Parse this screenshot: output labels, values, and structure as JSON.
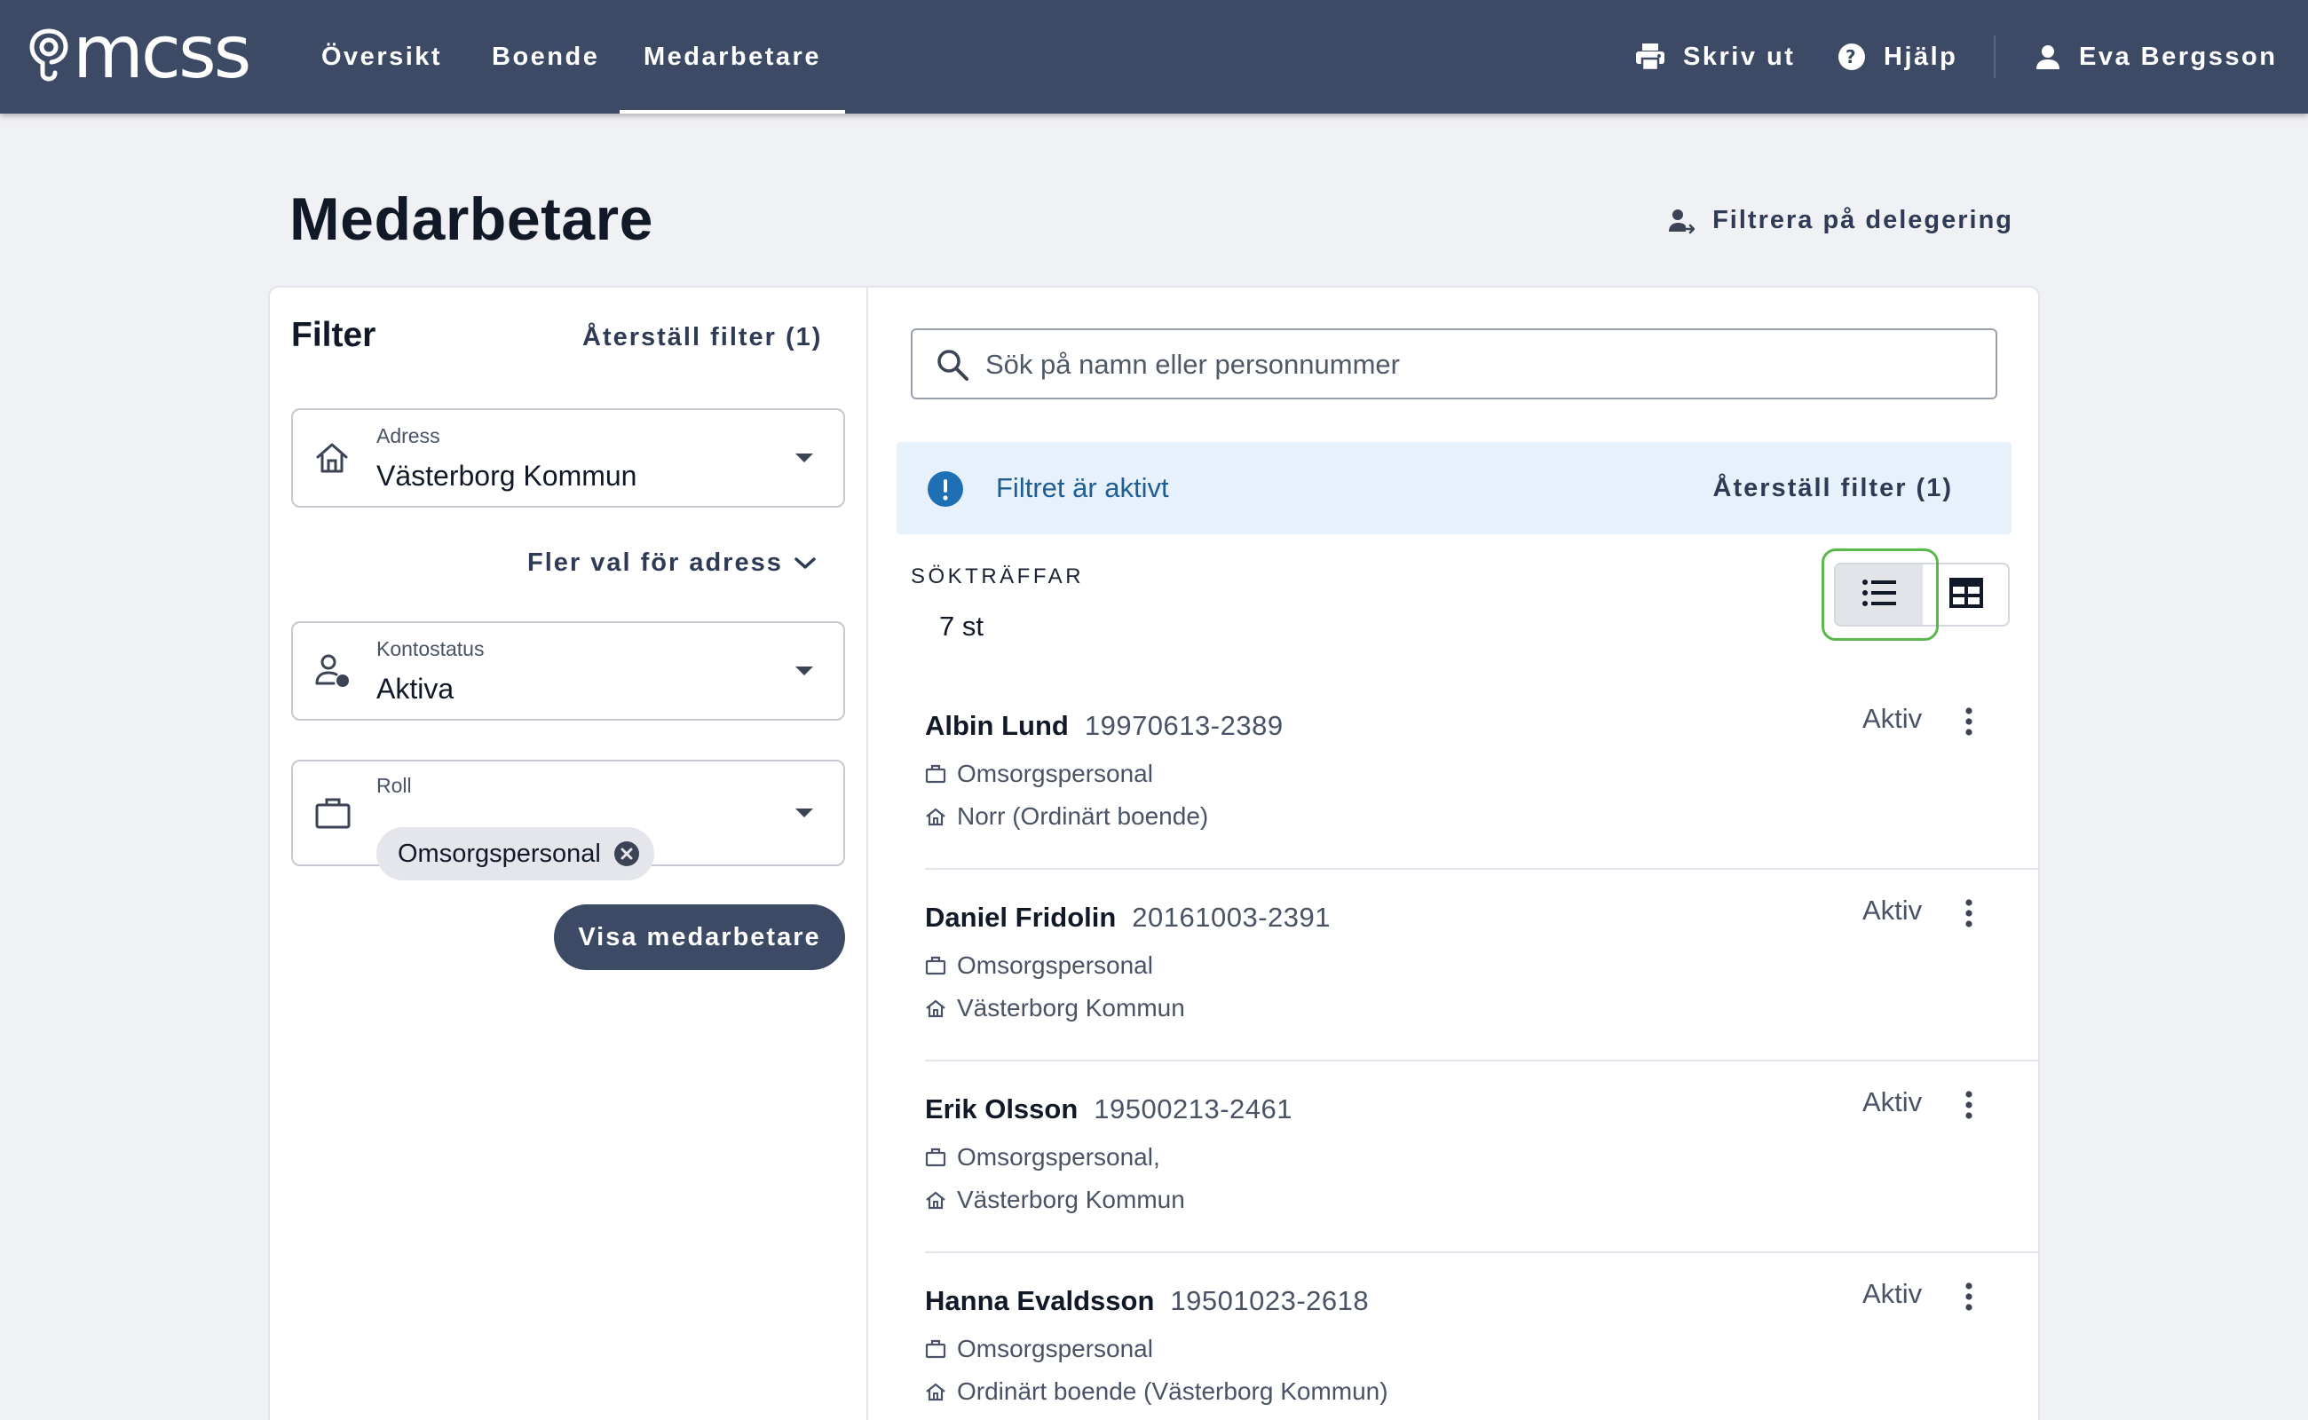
{
  "app": {
    "logo_text": "mcss"
  },
  "nav": {
    "tabs": [
      {
        "label": "Översikt"
      },
      {
        "label": "Boende"
      },
      {
        "label": "Medarbetare",
        "active": true
      }
    ],
    "print_label": "Skriv ut",
    "help_label": "Hjälp",
    "user_name": "Eva Bergsson"
  },
  "page": {
    "title": "Medarbetare",
    "delegation_filter_label": "Filtrera på delegering"
  },
  "filter": {
    "title": "Filter",
    "reset_label": "Återställ filter (1)",
    "address": {
      "label": "Adress",
      "value": "Västerborg Kommun"
    },
    "more_address_label": "Fler val för adress",
    "account_status": {
      "label": "Kontostatus",
      "value": "Aktiva"
    },
    "role": {
      "label": "Roll",
      "chip": "Omsorgspersonal"
    },
    "show_button_label": "Visa medarbetare"
  },
  "search": {
    "placeholder": "Sök på namn eller personnummer",
    "value": ""
  },
  "alert": {
    "message": "Filtret är aktivt",
    "reset_label": "Återställ filter (1)"
  },
  "results": {
    "hits_label": "SÖKTRÄFFAR",
    "hits_count": "7 st",
    "view_mode": "list",
    "rows": [
      {
        "name": "Albin Lund",
        "pnr": "19970613-2389",
        "role": "Omsorgspersonal",
        "address": "Norr (Ordinärt boende)",
        "status": "Aktiv"
      },
      {
        "name": "Daniel Fridolin",
        "pnr": "20161003-2391",
        "role": "Omsorgspersonal",
        "address": "Västerborg Kommun",
        "status": "Aktiv"
      },
      {
        "name": "Erik Olsson",
        "pnr": "19500213-2461",
        "role": "Omsorgspersonal,",
        "address": "Västerborg Kommun",
        "status": "Aktiv"
      },
      {
        "name": "Hanna Evaldsson",
        "pnr": "19501023-2618",
        "role": "Omsorgspersonal",
        "address": "Ordinärt boende (Västerborg Kommun)",
        "status": "Aktiv"
      }
    ]
  },
  "colors": {
    "topbar": "#3d4a66",
    "background": "#f0f1f5",
    "alert_bg": "#e6f1fc",
    "alert_accent": "#1f6fb5",
    "focus_ring": "#58b84a"
  },
  "icons": {
    "logo": "mcss-logo-icon",
    "print": "printer-icon",
    "help": "help-circle-icon",
    "user": "person-icon",
    "delegation": "person-arrow-icon",
    "address": "home-icon",
    "account_status": "person-status-icon",
    "role": "briefcase-icon",
    "chip_remove": "cancel-circle-icon",
    "search": "search-icon",
    "alert": "exclamation-circle-icon",
    "list_view": "list-icon",
    "table_view": "table-icon",
    "row_menu": "more-vertical-icon"
  }
}
